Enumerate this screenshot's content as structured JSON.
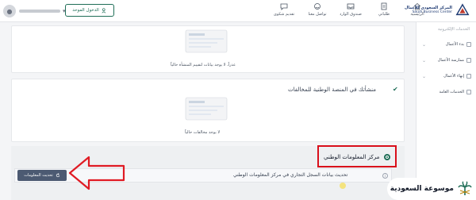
{
  "header": {
    "nafath_label": "الدخول الموحد",
    "nav": [
      {
        "label": "الرئيسية",
        "icon": "home-icon"
      },
      {
        "label": "طلباتي",
        "icon": "requests-icon"
      },
      {
        "label": "صندوق الوارد",
        "icon": "inbox-icon"
      },
      {
        "label": "تواصل معنا",
        "icon": "contact-icon"
      },
      {
        "label": "تقديم شكوى",
        "icon": "complaint-icon"
      }
    ],
    "logo_ar": "المركز السعودي للأعمال",
    "logo_en": "Saudi Business Center"
  },
  "sidebar": {
    "heading": "الخدمات الإلكترونية",
    "items": [
      {
        "label": "بدء الأعمال"
      },
      {
        "label": "ممارسة الأعمال"
      },
      {
        "label": "إنهاء الأعمال"
      },
      {
        "label": "الخدمات العامة"
      }
    ]
  },
  "cards": {
    "evaluation_empty": "عذراً، لا يوجد بيانات لتقييم المنشأة حالياً",
    "violations_title": "منشأتك في المنصة الوطنية للمخالفات",
    "violations_empty": "لا يوجد مخالفات حالياً"
  },
  "info_center": {
    "radio_label": "مركز المعلومات الوطني",
    "row_text": "تحديث بيانات السجل التجاري في مركز المعلومات الوطني",
    "button_label": "تحديث المعلومات"
  },
  "watermark": {
    "text": "موسوعة السعودية"
  },
  "colors": {
    "brand_green": "#1f6e57",
    "highlight_red": "#d90f1b",
    "button_slate": "#4c5a72"
  }
}
